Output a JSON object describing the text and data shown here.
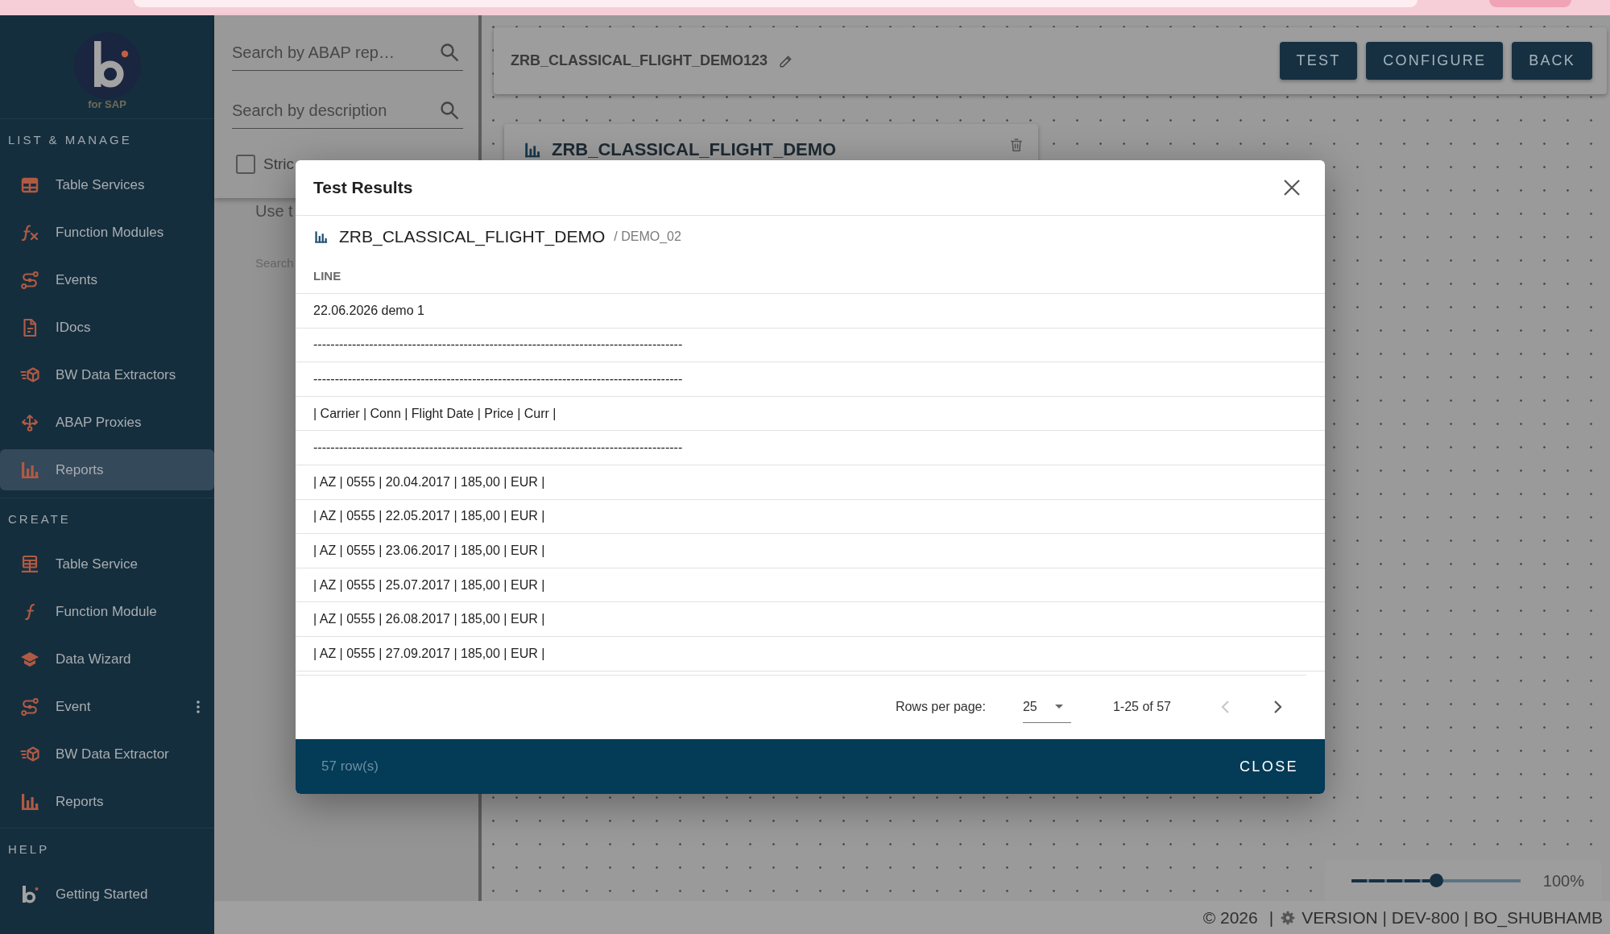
{
  "sidebar": {
    "logo_caption": "for SAP",
    "sections": [
      {
        "title": "LIST & MANAGE",
        "items": [
          {
            "label": "Table Services",
            "selected": false,
            "more_menu": false
          },
          {
            "label": "Function Modules",
            "selected": false,
            "more_menu": false
          },
          {
            "label": "Events",
            "selected": false,
            "more_menu": false
          },
          {
            "label": "IDocs",
            "selected": false,
            "more_menu": false
          },
          {
            "label": "BW Data Extractors",
            "selected": false,
            "more_menu": false
          },
          {
            "label": "ABAP Proxies",
            "selected": false,
            "more_menu": false
          },
          {
            "label": "Reports",
            "selected": true,
            "more_menu": false
          }
        ]
      },
      {
        "title": "CREATE",
        "items": [
          {
            "label": "Table Service",
            "selected": false,
            "more_menu": false
          },
          {
            "label": "Function Module",
            "selected": false,
            "more_menu": false
          },
          {
            "label": "Data Wizard",
            "selected": false,
            "more_menu": false
          },
          {
            "label": "Event",
            "selected": false,
            "more_menu": true
          },
          {
            "label": "BW Data Extractor",
            "selected": false,
            "more_menu": false
          },
          {
            "label": "Reports",
            "selected": false,
            "more_menu": false
          }
        ]
      },
      {
        "title": "HELP",
        "items": [
          {
            "label": "Getting Started",
            "selected": false,
            "more_menu": false
          }
        ]
      }
    ]
  },
  "search_panel": {
    "fields": [
      {
        "placeholder": "Search by ABAP rep…"
      },
      {
        "placeholder": "Search by description"
      }
    ],
    "checkbox": {
      "label": "Stric",
      "checked": false
    },
    "hint": "Use t",
    "caption": "Search"
  },
  "header": {
    "title": "ZRB_CLASSICAL_FLIGHT_DEMO123",
    "buttons": [
      "TEST",
      "CONFIGURE",
      "BACK"
    ]
  },
  "canvas": {
    "node": {
      "title": "ZRB_CLASSICAL_FLIGHT_DEMO"
    },
    "zoom": {
      "level": 0.5,
      "reading": "100%"
    }
  },
  "dialog": {
    "title": "Test Results",
    "report": {
      "name": "ZRB_CLASSICAL_FLIGHT_DEMO",
      "variant": "/ DEMO_02"
    },
    "table": {
      "columns": [
        "LINE"
      ],
      "rows": [
        [
          "22.06.2026 demo 1"
        ],
        [
          "--------------------------------------------------------------------------------------"
        ],
        [
          "--------------------------------------------------------------------------------------"
        ],
        [
          "| Carrier | Conn | Flight Date | Price | Curr |"
        ],
        [
          "--------------------------------------------------------------------------------------"
        ],
        [
          "| AZ | 0555 | 20.04.2017 | 185,00 | EUR |"
        ],
        [
          "| AZ | 0555 | 22.05.2017 | 185,00 | EUR |"
        ],
        [
          "| AZ | 0555 | 23.06.2017 | 185,00 | EUR |"
        ],
        [
          "| AZ | 0555 | 25.07.2017 | 185,00 | EUR |"
        ],
        [
          "| AZ | 0555 | 26.08.2017 | 185,00 | EUR |"
        ],
        [
          "| AZ | 0555 | 27.09.2017 | 185,00 | EUR |"
        ]
      ]
    },
    "pagination": {
      "label": "Rows per page:",
      "rows_per_page": "25",
      "range": "1-25 of 57",
      "previous": {
        "disabled": true
      },
      "next": {
        "disabled": false
      }
    },
    "footer": {
      "row_count": "57 row(s)",
      "close": "CLOSE"
    }
  },
  "status_bar": {
    "copyright": "© 2026",
    "separator": "|",
    "version": "VERSION | DEV-800 | BO_SHUBHAMB"
  }
}
